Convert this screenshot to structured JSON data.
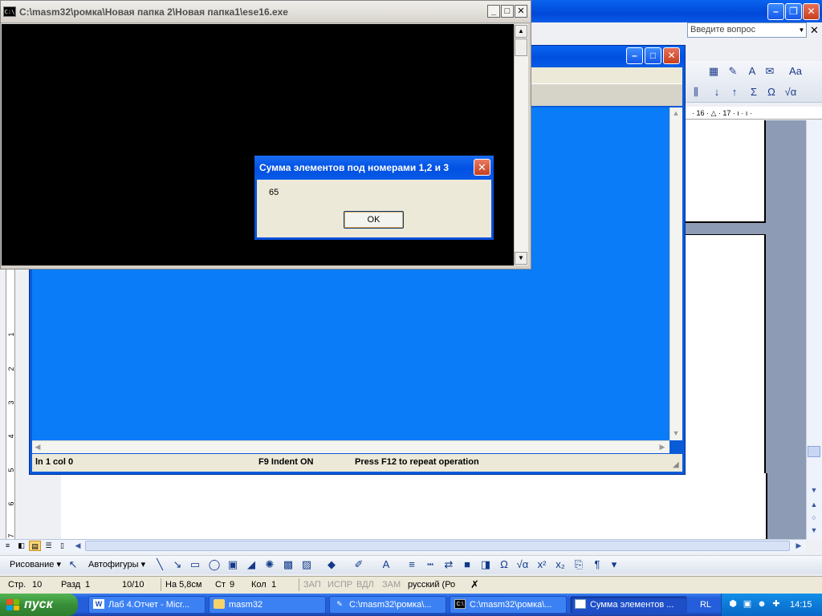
{
  "word": {
    "ask_placeholder": "Введите вопрос",
    "toolbar_icons": [
      "columns-icon",
      "sort-icon",
      "sort-desc-icon",
      "sum-icon",
      "omega-icon",
      "sqrt-icon"
    ],
    "ruler_marks": "· 16 · △ · 17 · ı · ı ·",
    "vruler_numbers": [
      "1",
      "2",
      "3",
      "4",
      "5",
      "6",
      "7"
    ],
    "draw_menu": "Рисование",
    "autoshapes_menu": "Автофигуры",
    "status": {
      "page": "Стр.",
      "page_num": "10",
      "section": "Разд",
      "section_num": "1",
      "page_of": "10/10",
      "at": "На 5,8см",
      "line": "Ст",
      "line_num": "9",
      "col": "Кол",
      "col_num": "1",
      "rec": "ЗАП",
      "trk": "ИСПР",
      "ext": "ВДЛ",
      "ovr": "ЗАМ",
      "lang": "русский (Ро"
    }
  },
  "editor": {
    "status_pos": "ln 1 col 0",
    "status_indent": "F9 Indent ON",
    "status_hint": "Press F12 to repeat operation"
  },
  "console": {
    "title": "C:\\masm32\\ромка\\Новая папка 2\\Новая папка1\\ese16.exe",
    "icon_text": "C:\\"
  },
  "msgbox": {
    "title": "Сумма элементов под номерами 1,2 и 3",
    "message": "65",
    "ok_label": "OK"
  },
  "taskbar": {
    "start_label": "пуск",
    "tasks": [
      {
        "label": "Лаб 4.Отчет - Micr...",
        "icon": "word-icon"
      },
      {
        "label": "masm32",
        "icon": "folder-icon"
      },
      {
        "label": "C:\\masm32\\ромка\\...",
        "icon": "editor-icon"
      },
      {
        "label": "C:\\masm32\\ромка\\...",
        "icon": "console-icon"
      },
      {
        "label": "Сумма элементов ...",
        "icon": "window-icon"
      }
    ],
    "lang": "RL",
    "clock": "14:15"
  },
  "colors": {
    "xp_blue": "#0a5ae8",
    "editor_blue": "#0a7cf8",
    "taskbar_blue": "#245edb",
    "start_green": "#388e38"
  }
}
